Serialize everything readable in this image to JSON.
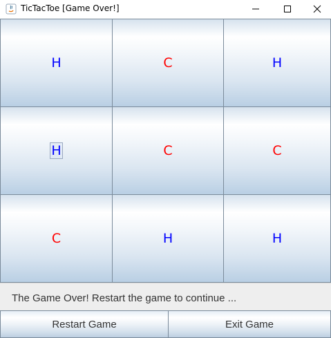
{
  "window": {
    "title": "TicTacToe [Game Over!]",
    "minimize_glyph": "–",
    "maximize_glyph": "☐",
    "close_glyph": "✕"
  },
  "board": {
    "cells": [
      "H",
      "C",
      "H",
      "H",
      "C",
      "C",
      "C",
      "H",
      "H"
    ],
    "colors": {
      "H": "#0000ff",
      "C": "#ff0000"
    }
  },
  "status": {
    "message": "The Game Over! Restart the game to continue ..."
  },
  "buttons": {
    "restart_label": "Restart Game",
    "exit_label": "Exit Game"
  }
}
